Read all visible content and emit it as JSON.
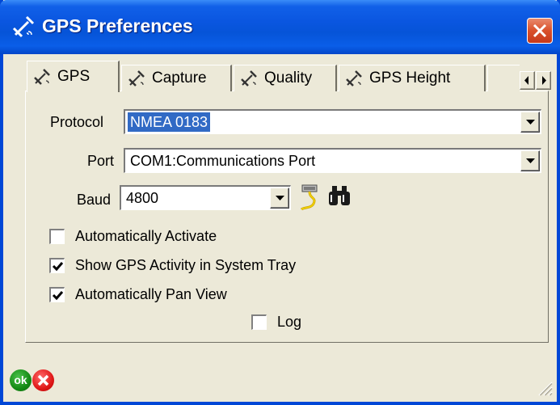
{
  "window": {
    "title": "GPS Preferences",
    "title_icon": "satellite-icon",
    "close_icon": "close-icon"
  },
  "tabs": [
    {
      "label": "GPS",
      "icon": "satellite-icon",
      "active": true
    },
    {
      "label": "Capture",
      "icon": "satellite-icon",
      "active": false
    },
    {
      "label": "Quality",
      "icon": "satellite-icon",
      "active": false
    },
    {
      "label": "GPS Height",
      "icon": "satellite-icon",
      "active": false
    }
  ],
  "tab_scroll": {
    "left_icon": "arrow-left-icon",
    "right_icon": "arrow-right-icon"
  },
  "form": {
    "protocol": {
      "label": "Protocol",
      "value": "NMEA 0183"
    },
    "port": {
      "label": "Port",
      "value": "COM1:Communications Port"
    },
    "baud": {
      "label": "Baud",
      "value": "4800"
    },
    "tools": {
      "cable_icon": "serial-cable-icon",
      "search_icon": "binoculars-icon"
    }
  },
  "options": {
    "auto_activate": {
      "label": "Automatically Activate",
      "checked": false
    },
    "show_tray": {
      "label": "Show GPS Activity in System Tray",
      "checked": true
    },
    "auto_pan": {
      "label": "Automatically Pan View",
      "checked": true
    },
    "log": {
      "label": "Log",
      "checked": false
    }
  },
  "footer": {
    "ok_label": "ok",
    "cancel_icon": "cancel-icon"
  },
  "colors": {
    "title_bar": "#0A56E0",
    "selection": "#316AC5",
    "dialog_bg": "#ECE9D8",
    "close_button": "#D9502B"
  }
}
